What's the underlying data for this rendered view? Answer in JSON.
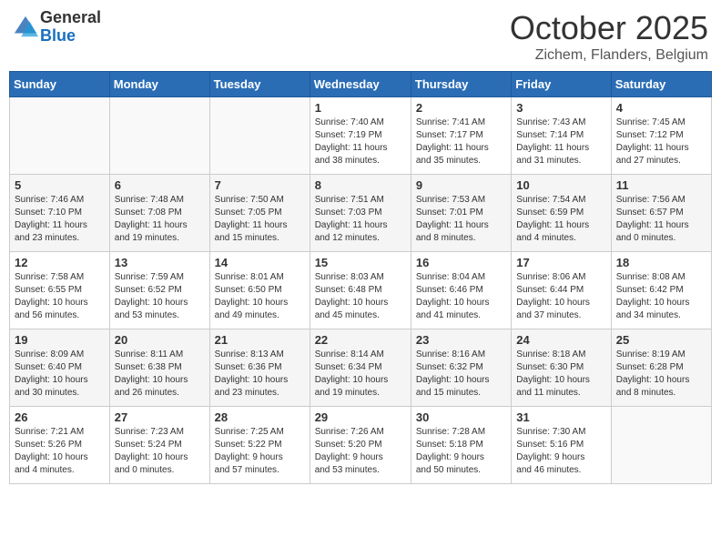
{
  "logo": {
    "general": "General",
    "blue": "Blue"
  },
  "header": {
    "month": "October 2025",
    "location": "Zichem, Flanders, Belgium"
  },
  "days_of_week": [
    "Sunday",
    "Monday",
    "Tuesday",
    "Wednesday",
    "Thursday",
    "Friday",
    "Saturday"
  ],
  "weeks": [
    [
      {
        "day": "",
        "info": ""
      },
      {
        "day": "",
        "info": ""
      },
      {
        "day": "",
        "info": ""
      },
      {
        "day": "1",
        "info": "Sunrise: 7:40 AM\nSunset: 7:19 PM\nDaylight: 11 hours\nand 38 minutes."
      },
      {
        "day": "2",
        "info": "Sunrise: 7:41 AM\nSunset: 7:17 PM\nDaylight: 11 hours\nand 35 minutes."
      },
      {
        "day": "3",
        "info": "Sunrise: 7:43 AM\nSunset: 7:14 PM\nDaylight: 11 hours\nand 31 minutes."
      },
      {
        "day": "4",
        "info": "Sunrise: 7:45 AM\nSunset: 7:12 PM\nDaylight: 11 hours\nand 27 minutes."
      }
    ],
    [
      {
        "day": "5",
        "info": "Sunrise: 7:46 AM\nSunset: 7:10 PM\nDaylight: 11 hours\nand 23 minutes."
      },
      {
        "day": "6",
        "info": "Sunrise: 7:48 AM\nSunset: 7:08 PM\nDaylight: 11 hours\nand 19 minutes."
      },
      {
        "day": "7",
        "info": "Sunrise: 7:50 AM\nSunset: 7:05 PM\nDaylight: 11 hours\nand 15 minutes."
      },
      {
        "day": "8",
        "info": "Sunrise: 7:51 AM\nSunset: 7:03 PM\nDaylight: 11 hours\nand 12 minutes."
      },
      {
        "day": "9",
        "info": "Sunrise: 7:53 AM\nSunset: 7:01 PM\nDaylight: 11 hours\nand 8 minutes."
      },
      {
        "day": "10",
        "info": "Sunrise: 7:54 AM\nSunset: 6:59 PM\nDaylight: 11 hours\nand 4 minutes."
      },
      {
        "day": "11",
        "info": "Sunrise: 7:56 AM\nSunset: 6:57 PM\nDaylight: 11 hours\nand 0 minutes."
      }
    ],
    [
      {
        "day": "12",
        "info": "Sunrise: 7:58 AM\nSunset: 6:55 PM\nDaylight: 10 hours\nand 56 minutes."
      },
      {
        "day": "13",
        "info": "Sunrise: 7:59 AM\nSunset: 6:52 PM\nDaylight: 10 hours\nand 53 minutes."
      },
      {
        "day": "14",
        "info": "Sunrise: 8:01 AM\nSunset: 6:50 PM\nDaylight: 10 hours\nand 49 minutes."
      },
      {
        "day": "15",
        "info": "Sunrise: 8:03 AM\nSunset: 6:48 PM\nDaylight: 10 hours\nand 45 minutes."
      },
      {
        "day": "16",
        "info": "Sunrise: 8:04 AM\nSunset: 6:46 PM\nDaylight: 10 hours\nand 41 minutes."
      },
      {
        "day": "17",
        "info": "Sunrise: 8:06 AM\nSunset: 6:44 PM\nDaylight: 10 hours\nand 37 minutes."
      },
      {
        "day": "18",
        "info": "Sunrise: 8:08 AM\nSunset: 6:42 PM\nDaylight: 10 hours\nand 34 minutes."
      }
    ],
    [
      {
        "day": "19",
        "info": "Sunrise: 8:09 AM\nSunset: 6:40 PM\nDaylight: 10 hours\nand 30 minutes."
      },
      {
        "day": "20",
        "info": "Sunrise: 8:11 AM\nSunset: 6:38 PM\nDaylight: 10 hours\nand 26 minutes."
      },
      {
        "day": "21",
        "info": "Sunrise: 8:13 AM\nSunset: 6:36 PM\nDaylight: 10 hours\nand 23 minutes."
      },
      {
        "day": "22",
        "info": "Sunrise: 8:14 AM\nSunset: 6:34 PM\nDaylight: 10 hours\nand 19 minutes."
      },
      {
        "day": "23",
        "info": "Sunrise: 8:16 AM\nSunset: 6:32 PM\nDaylight: 10 hours\nand 15 minutes."
      },
      {
        "day": "24",
        "info": "Sunrise: 8:18 AM\nSunset: 6:30 PM\nDaylight: 10 hours\nand 11 minutes."
      },
      {
        "day": "25",
        "info": "Sunrise: 8:19 AM\nSunset: 6:28 PM\nDaylight: 10 hours\nand 8 minutes."
      }
    ],
    [
      {
        "day": "26",
        "info": "Sunrise: 7:21 AM\nSunset: 5:26 PM\nDaylight: 10 hours\nand 4 minutes."
      },
      {
        "day": "27",
        "info": "Sunrise: 7:23 AM\nSunset: 5:24 PM\nDaylight: 10 hours\nand 0 minutes."
      },
      {
        "day": "28",
        "info": "Sunrise: 7:25 AM\nSunset: 5:22 PM\nDaylight: 9 hours\nand 57 minutes."
      },
      {
        "day": "29",
        "info": "Sunrise: 7:26 AM\nSunset: 5:20 PM\nDaylight: 9 hours\nand 53 minutes."
      },
      {
        "day": "30",
        "info": "Sunrise: 7:28 AM\nSunset: 5:18 PM\nDaylight: 9 hours\nand 50 minutes."
      },
      {
        "day": "31",
        "info": "Sunrise: 7:30 AM\nSunset: 5:16 PM\nDaylight: 9 hours\nand 46 minutes."
      },
      {
        "day": "",
        "info": ""
      }
    ]
  ]
}
